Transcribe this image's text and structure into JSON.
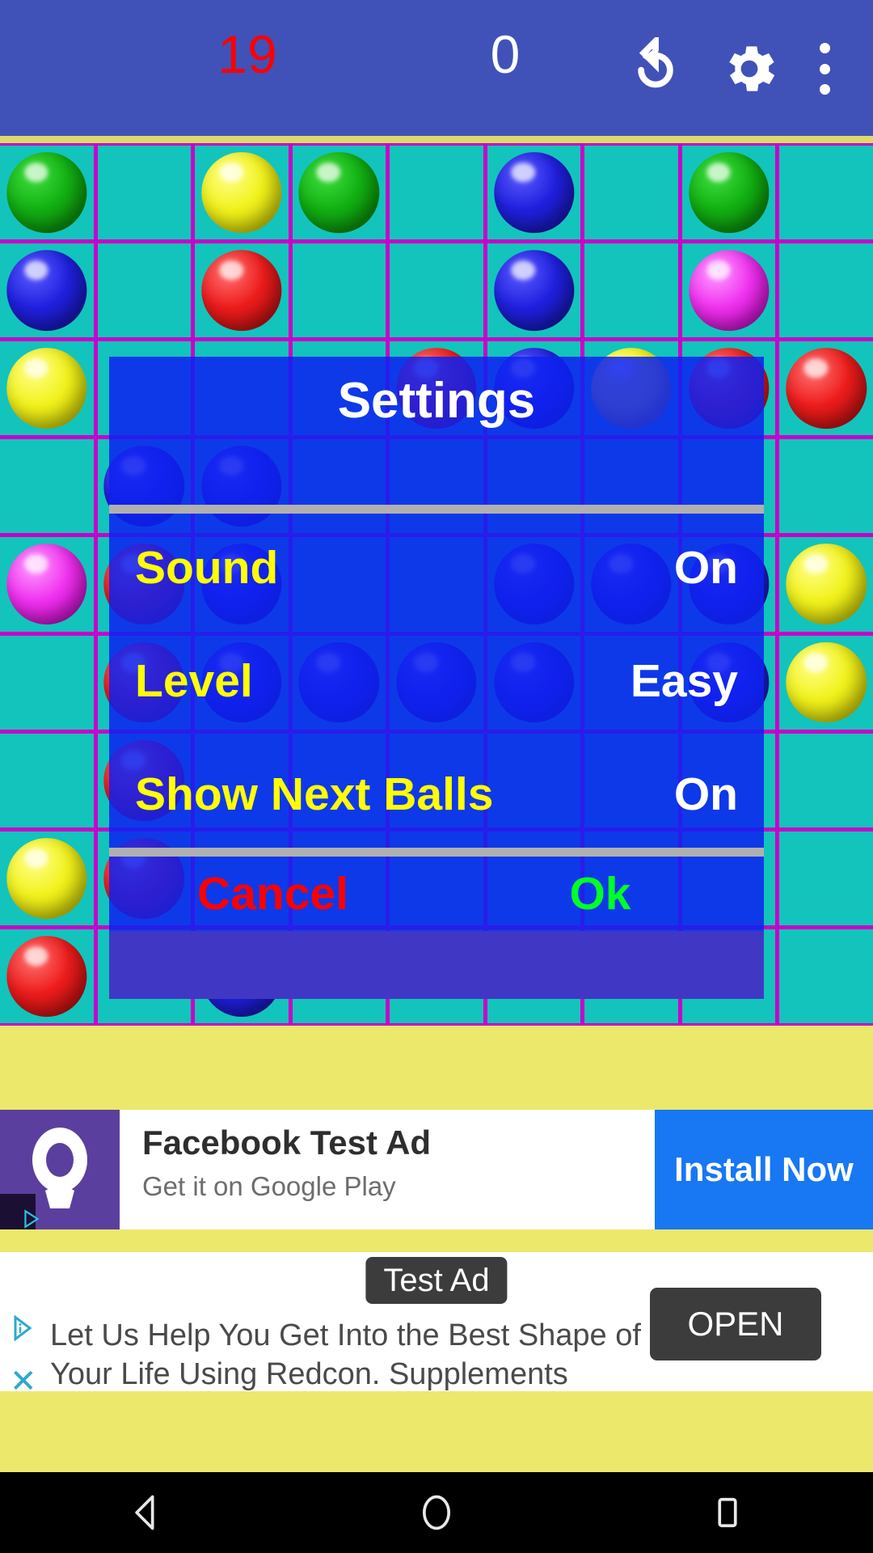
{
  "header": {
    "moves": "19",
    "score": "0",
    "undo_icon": "undo-restart-icon",
    "settings_icon": "gear-icon",
    "menu_icon": "overflow-menu-icon"
  },
  "dialog": {
    "title": "Settings",
    "rows": [
      {
        "label": "Sound",
        "value": "On"
      },
      {
        "label": "Level",
        "value": "Easy"
      },
      {
        "label": "Show Next Balls",
        "value": "On"
      }
    ],
    "cancel_label": "Cancel",
    "ok_label": "Ok"
  },
  "board": {
    "columns": 9,
    "rows": 9,
    "cell_color": "#12c4bc",
    "grid_line_color": "#c800c8",
    "balls": [
      {
        "row": 0,
        "col": 0,
        "color": "green"
      },
      {
        "row": 0,
        "col": 2,
        "color": "yellow"
      },
      {
        "row": 0,
        "col": 3,
        "color": "green"
      },
      {
        "row": 0,
        "col": 5,
        "color": "blue"
      },
      {
        "row": 0,
        "col": 7,
        "color": "green"
      },
      {
        "row": 1,
        "col": 0,
        "color": "blue"
      },
      {
        "row": 1,
        "col": 2,
        "color": "red"
      },
      {
        "row": 1,
        "col": 5,
        "color": "blue"
      },
      {
        "row": 1,
        "col": 7,
        "color": "magenta"
      },
      {
        "row": 2,
        "col": 0,
        "color": "yellow"
      },
      {
        "row": 2,
        "col": 4,
        "color": "red"
      },
      {
        "row": 2,
        "col": 5,
        "color": "blue"
      },
      {
        "row": 2,
        "col": 6,
        "color": "yellow"
      },
      {
        "row": 2,
        "col": 7,
        "color": "red"
      },
      {
        "row": 2,
        "col": 8,
        "color": "red"
      },
      {
        "row": 3,
        "col": 1,
        "color": "blue"
      },
      {
        "row": 3,
        "col": 2,
        "color": "blue"
      },
      {
        "row": 4,
        "col": 0,
        "color": "magenta"
      },
      {
        "row": 4,
        "col": 1,
        "color": "red"
      },
      {
        "row": 4,
        "col": 2,
        "color": "blue"
      },
      {
        "row": 4,
        "col": 5,
        "color": "blue"
      },
      {
        "row": 4,
        "col": 6,
        "color": "blue"
      },
      {
        "row": 4,
        "col": 7,
        "color": "blue"
      },
      {
        "row": 4,
        "col": 8,
        "color": "yellow"
      },
      {
        "row": 5,
        "col": 1,
        "color": "red"
      },
      {
        "row": 5,
        "col": 2,
        "color": "blue"
      },
      {
        "row": 5,
        "col": 3,
        "color": "blue"
      },
      {
        "row": 5,
        "col": 4,
        "color": "blue"
      },
      {
        "row": 5,
        "col": 5,
        "color": "blue"
      },
      {
        "row": 5,
        "col": 7,
        "color": "blue"
      },
      {
        "row": 5,
        "col": 8,
        "color": "yellow"
      },
      {
        "row": 6,
        "col": 1,
        "color": "red"
      },
      {
        "row": 7,
        "col": 0,
        "color": "yellow"
      },
      {
        "row": 7,
        "col": 1,
        "color": "red"
      },
      {
        "row": 8,
        "col": 0,
        "color": "red"
      },
      {
        "row": 8,
        "col": 2,
        "color": "blue"
      }
    ]
  },
  "ad_banner": {
    "title": "Facebook Test Ad",
    "subtitle": "Get it on Google Play",
    "cta_label": "Install Now",
    "logo_icon": "facebook-audience-network-logo-icon",
    "adchoices_icon": "adchoices-icon"
  },
  "ad_native": {
    "badge": "Test Ad",
    "body": "Let Us Help You Get Into the Best Shape of Your Life Using Redcon. Supplements",
    "cta_label": "OPEN",
    "adchoices_icon": "adchoices-icon",
    "close_icon": "close-icon"
  },
  "navbar": {
    "back_icon": "back-triangle-icon",
    "home_icon": "home-circle-icon",
    "recents_icon": "recents-square-icon"
  },
  "colors": {
    "header_bg": "#4052b8",
    "board_cell": "#12c4bc",
    "board_line": "#c800c8",
    "dialog_bg": "#0e22f0",
    "frame_yellow": "#ece86b",
    "label_yellow": "#ffff00",
    "moves_red": "#ff0000",
    "ok_green": "#00ff28",
    "cta_blue": "#1877f2"
  }
}
